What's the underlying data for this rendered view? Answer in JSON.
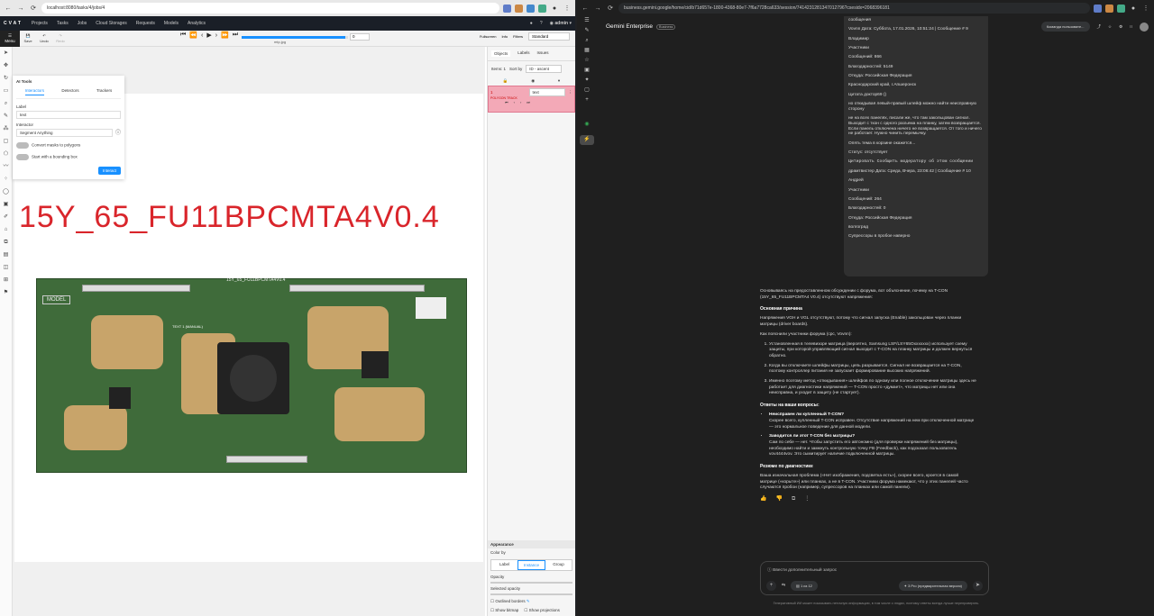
{
  "left_browser": {
    "url": "localhost:8080/tasks/4/jobs/4"
  },
  "cvat": {
    "logo": "CVAT",
    "nav": [
      "Projects",
      "Tasks",
      "Jobs",
      "Cloud Storages",
      "Requests",
      "Models",
      "Analytics"
    ],
    "user": "admin",
    "toolbar": {
      "menu": "Menu",
      "save": "Save",
      "undo": "Undo",
      "redo": "Redo",
      "fullscreen": "Fullscreen",
      "info": "Info",
      "filters": "Filters",
      "mode": "Standard",
      "frame_value": "0",
      "filename": "mtp.jpg"
    },
    "ai_tools": {
      "title": "AI Tools",
      "tabs": [
        "Interactors",
        "Detectors",
        "Trackers"
      ],
      "label_caption": "Label",
      "label_value": "text",
      "interactor_caption": "Interactor",
      "interactor_value": "Segment Anything",
      "convert_masks": "Convert masks to polygons",
      "bounding_box": "Start with a bounding box",
      "interact_button": "Interact"
    },
    "image": {
      "big_text": "15Y_65_FU11BPCMTA4V0.4",
      "board_label": "15Y_65_FU11BPCMTA4V0.4",
      "model_label": "MODEL",
      "annotation_tag": "TEXT 1 (MANUAL)"
    },
    "sidebar": {
      "tabs": [
        "Objects",
        "Labels",
        "Issues"
      ],
      "items_label": "Items: 1",
      "sort_label": "Sort by",
      "sort_value": "ID - ascent",
      "object_id": "1",
      "object_type": "POLYGON TRACK",
      "object_label": "text",
      "appearance": "Appearance",
      "color_by": "Color by",
      "color_options": [
        "Label",
        "Instance",
        "Group"
      ],
      "opacity": "Opacity",
      "selected_opacity": "Selected opacity",
      "outlined_borders": "Outlined borders",
      "show_bitmap": "Show bitmap",
      "show_projections": "Show projections"
    }
  },
  "right_browser": {
    "url": "business.gemini.google/home/cid/b71d657e-1800-4368-80e7-7f6a7728ca633/session/7414231281347012796?csesidx=2068396181"
  },
  "gemini": {
    "title": "Gemini Enterprise",
    "badge": "Business",
    "team_button": "Команда пользовате... ",
    "bubble_lines": [
      "сообщения",
      "Vovnn Дата: Суббота, 17.01.2026, 10:51:24 | Сообщение # 9",
      "Владимир",
      "Участники",
      "Сообщений: 866",
      "Благодарностей: 5149",
      "Откуда: Российская Федерация",
      "Краснодарский край, г.Апшеронск",
      "Цитата доктор69 ()",
      "но откидывая левый-правый шлейф можно найти неисправную сторону",
      "не на всех панелях, писали же, что там закольцован сигнал. Выходит с ткон с одного разъема на планку, затем возвращается. Если панель отключена ничего не возвращается. От того и ничего не работает. Нужно чинить перемычку.",
      "Опять тема в корзине окажется...",
      "Статус: отсутствует",
      "Цитировать Сообщить модератору об этом сообщении",
      "драмтвистер Дата: Среда, Вчера, 23:06:42 | Сообщение # 10",
      "Андрей",
      "Участники",
      "Сообщений: 264",
      "Благодарностей: 0",
      "Откуда: Российская Федерация",
      "волгоград",
      "Супрессоры в пробое наверно"
    ],
    "answer": {
      "intro": "Основываясь на предоставленном обсуждении с форума, вот объяснение, почему на T-CON (15Y_65_FU11BPCMTA4 V0.4) отсутствуют напряжения:",
      "h1": "Основная причина",
      "p1": "Напряжения VGH и VGL отсутствуют, потому что сигнал запуска (Enable) закольцован через планки матрицы (driver boards).",
      "p2": "Как пояснили участники форума (cpc, Vovnn):",
      "list": [
        "Установленная в телевизоре матрица (вероятно, Samsung LSF/LSY65Oxxxxxxx) использует схему защиты, при которой управляющий сигнал выходит с T-CON на планку матрицы и должен вернуться обратно.",
        "Когда вы отключаете шлейфы матрицы, цепь разрывается. Сигнал не возвращается на T-CON, поэтому контроллер питания не запускает формирование высоких напряжений.",
        "Именно поэтому метод «откидывания» шлейфов по одному или полное отключение матрицы здесь не работает для диагностики напряжений — T-CON просто «думает», что матрицы нет или она неисправна, и уходит в защиту (не стартует)."
      ],
      "h2": "Ответы на ваши вопросы:",
      "q1": "Неисправен ли купленный T-CON?",
      "a1": "Скорее всего, купленный T-CON исправен. Отсутствие напряжений на нем при отключенной матрице — это нормальное поведение для данной модели.",
      "q2": "Заводится ли этот T-CON без матрицы?",
      "a2": "Сам по себе — нет. Чтобы запустить его автономно (для проверки напряжений без матрицы), необходимо найти и замкнуть контрольную точку FB (Feedback), как подсказал пользователь vov4444vov. Это сымитирует наличие подключенной матрицы.",
      "h3": "Резюме по диагностике",
      "summary": "Ваша изначальная проблема («Нет изображения, подсветка есть»), скорее всего, кроется в самой матрице («корыте») или планках, а не в T-CON. Участники форума намекают, что у этих панелей часто случаются пробои (например, супрессоров на планках или самой панели)."
    },
    "composer_placeholder": "Ввести дополнительный запрос",
    "sources": "1 из 12",
    "model": "3 Pro (предварительная версия)",
    "disclaimer": "Генеративный ИИ может показывать неточную информацию, в том числе о людях, поэтому ответы всегда лучше перепроверять."
  }
}
